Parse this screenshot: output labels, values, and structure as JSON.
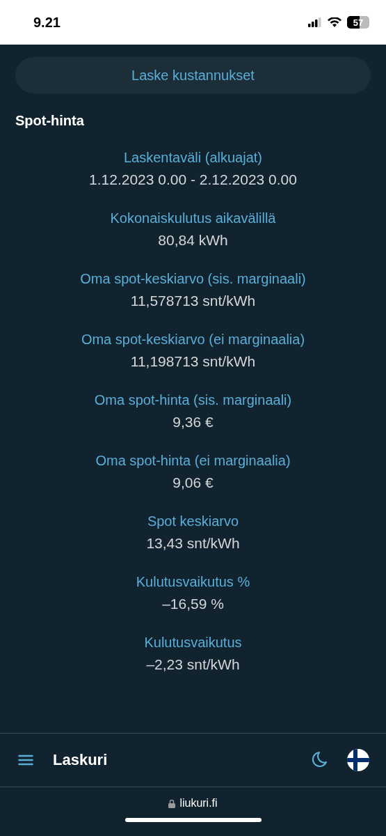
{
  "status_bar": {
    "time": "9.21",
    "battery": "57"
  },
  "calculate_button": {
    "label": "Laske kustannukset"
  },
  "section": {
    "title": "Spot-hinta",
    "stats": [
      {
        "label": "Laskentaväli (alkuajat)",
        "value": "1.12.2023 0.00 - 2.12.2023 0.00"
      },
      {
        "label": "Kokonaiskulutus aikavälillä",
        "value": "80,84 kWh"
      },
      {
        "label": "Oma spot-keskiarvo (sis. marginaali)",
        "value": "11,578713 snt/kWh"
      },
      {
        "label": "Oma spot-keskiarvo (ei marginaalia)",
        "value": "11,198713 snt/kWh"
      },
      {
        "label": "Oma spot-hinta (sis. marginaali)",
        "value": "9,36 €"
      },
      {
        "label": "Oma spot-hinta (ei marginaalia)",
        "value": "9,06 €"
      },
      {
        "label": "Spot keskiarvo",
        "value": "13,43 snt/kWh"
      },
      {
        "label": "Kulutusvaikutus %",
        "value": "–16,59 %"
      },
      {
        "label": "Kulutusvaikutus",
        "value": "–2,23 snt/kWh"
      }
    ]
  },
  "nav_bar": {
    "title": "Laskuri"
  },
  "url_bar": {
    "url": "liukuri.fi"
  }
}
